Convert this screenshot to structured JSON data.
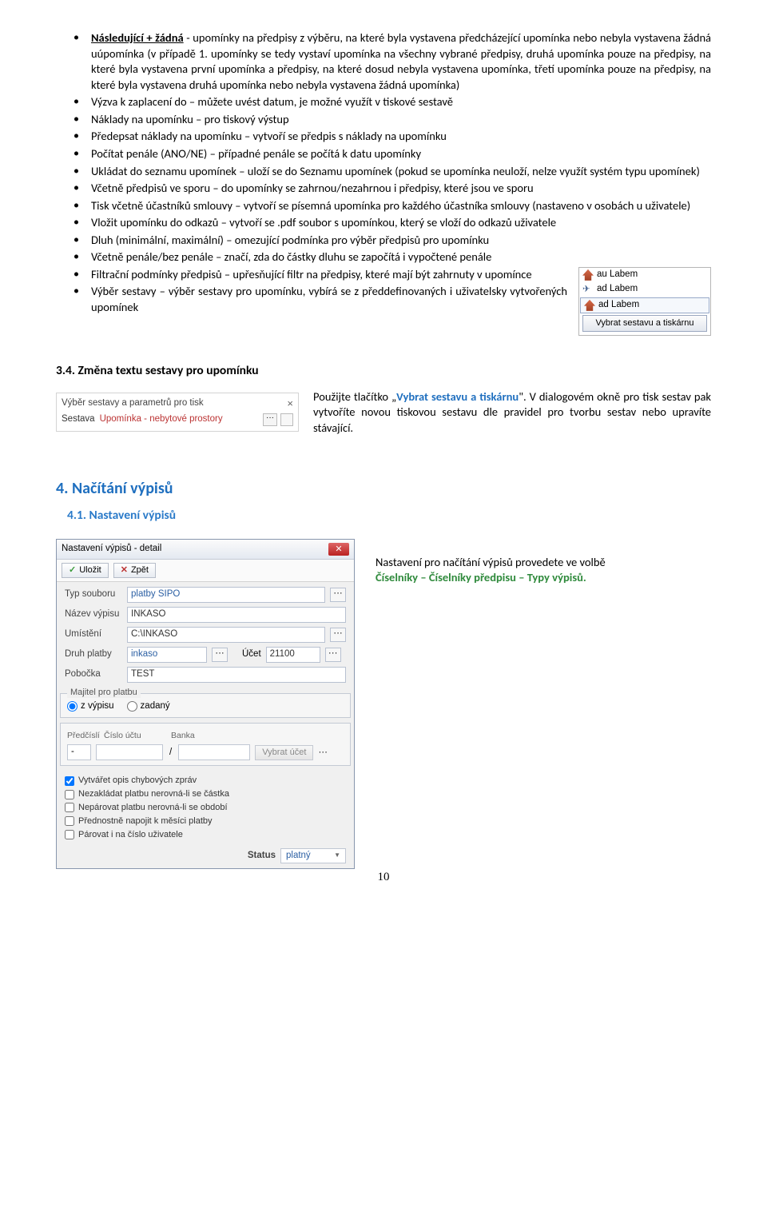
{
  "bullets": [
    {
      "pre": "Následující + žádná",
      "pre_u": true,
      "pre_b": true,
      "rest": " - upomínky na předpisy z výběru, na které byla vystavena předcházející upomínka nebo nebyla vystavena žádná uúpomínka (v případě 1. upomínky se tedy vystaví upomínka na všechny vybrané předpisy, druhá upomínka pouze na předpisy, na které byla vystavena první upomínka a předpisy, na které dosud nebyla vystavena upomínka, třetí upomínka pouze na předpisy, na které byla vystavena druhá upomínka nebo nebyla vystavena žádná upomínka)"
    },
    {
      "text": "Výzva k zaplacení do – můžete uvést datum, je možné využít v tiskové sestavě"
    },
    {
      "text": "Náklady na upomínku – pro tiskový výstup"
    },
    {
      "text": "Předepsat náklady na upomínku – vytvoří se předpis s náklady na upomínku"
    },
    {
      "text": "Počítat penále (ANO/NE) – případné penále se počítá k datu upomínky"
    },
    {
      "text": "Ukládat do seznamu upomínek – uloží se do Seznamu upomínek (pokud se upomínka neuloží, nelze využít systém typu upomínek)"
    },
    {
      "text": "Včetně předpisů ve sporu – do upomínky se zahrnou/nezahrnou i předpisy, které jsou ve sporu"
    },
    {
      "text": "Tisk včetně účastníků smlouvy – vytvoří se písemná upomínka pro každého účastníka smlouvy (nastaveno v osobách u uživatele)"
    },
    {
      "text": "Vložit upomínku do odkazů – vytvoří se .pdf soubor s upomínkou, který se vloží do odkazů uživatele"
    },
    {
      "text": "Dluh (minimální, maximální) – omezující podmínka pro výběr předpisů pro upomínku"
    },
    {
      "text": "Včetně penále/bez penále – značí, zda do částky dluhu se započítá i vypočtené penále"
    },
    {
      "text": "Filtrační podmínky předpisů – upřesňující filtr na předpisy, které mají být zahrnuty v upomínce",
      "wrap": true
    },
    {
      "text": "Výběr sestavy – výběr sestavy pro upomínku, vybírá se z předdefinovaných i uživatelsky vytvořených upomínek",
      "wrap": true
    }
  ],
  "rightbox": {
    "row1": "au Labem",
    "row2": "ad Labem",
    "row3": "ad Labem",
    "btn": "Vybrat sestavu a tiskárnu"
  },
  "sec34": {
    "title": "3.4. Změna textu sestavy pro upomínku",
    "vyber_title": "Výběr sestavy a parametrů pro tisk",
    "vyber_label": "Sestava",
    "vyber_value": "Upomínka - nebytové prostory",
    "para_pre": "Použijte tlačítko „",
    "para_bold": "Vybrat sestavu a tiskárnu",
    "para_post": "\". V dialogovém okně pro tisk sestav pak vytvoříte novou tiskovou sestavu dle pravidel pro tvorbu sestav nebo upravíte stávající."
  },
  "h4": "4. Načítání výpisů",
  "h41": "4.1. Nastavení výpisů",
  "dlg": {
    "title": "Nastavení výpisů - detail",
    "save": "Uložit",
    "back": "Zpět",
    "labels": {
      "typ": "Typ souboru",
      "typ_v": "platby SIPO",
      "nazev": "Název výpisu",
      "nazev_v": "INKASO",
      "umisteni": "Umístění",
      "umisteni_v": "C:\\INKASO",
      "druh": "Druh platby",
      "druh_v": "inkaso",
      "ucet_l": "Účet",
      "ucet_v": "21100",
      "pobocka": "Pobočka",
      "pobocka_v": "TEST",
      "grp1": "Majitel pro platbu",
      "r1": "z výpisu",
      "r2": "zadaný",
      "predcisli": "Předčíslí",
      "cislo": "Číslo účtu",
      "banka": "Banka",
      "vybrat_ucet": "Vybrat účet"
    },
    "checks": [
      {
        "label": "Vytvářet opis chybových zpráv",
        "checked": true
      },
      {
        "label": "Nezakládat platbu nerovná-li se částka",
        "checked": false
      },
      {
        "label": "Nepárovat platbu nerovná-li se období",
        "checked": false
      },
      {
        "label": "Přednostně napojit k měsíci platby",
        "checked": false
      },
      {
        "label": "Párovat i na číslo uživatele",
        "checked": false
      }
    ],
    "status_l": "Status",
    "status_v": "platný"
  },
  "right_text": {
    "line1": "Nastavení pro načítání výpisů provedete ve volbě",
    "line2": "Číselníky – Číselníky předpisu – Typy výpisů."
  },
  "page": "10"
}
